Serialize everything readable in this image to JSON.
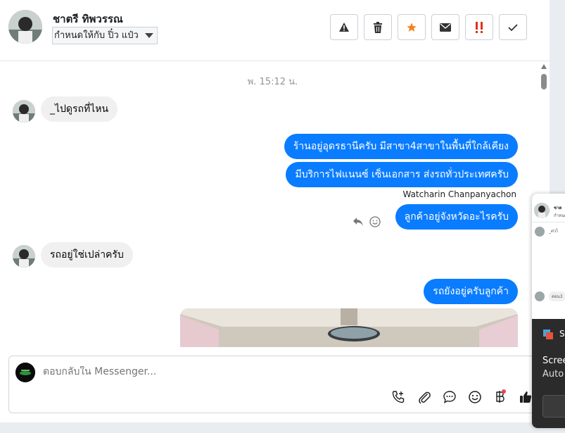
{
  "header": {
    "contact_name": "ชาตรี ทิพวรรณ",
    "assign_label": "กำหนดให้กับ ปิ๋ว แป๋ว",
    "actions": [
      {
        "name": "alert-button",
        "icon": "warning-icon"
      },
      {
        "name": "delete-button",
        "icon": "trash-icon"
      },
      {
        "name": "star-button",
        "icon": "star-icon"
      },
      {
        "name": "mail-button",
        "icon": "envelope-icon"
      },
      {
        "name": "urgent-button",
        "icon": "double-exclamation-icon"
      },
      {
        "name": "done-button",
        "icon": "check-icon"
      }
    ]
  },
  "conversation": {
    "timestamp": "พ. 15:12 น.",
    "messages": [
      {
        "direction": "in",
        "text": "_ไปดูรถที่ไหน"
      },
      {
        "direction": "out",
        "text": "ร้านอยู่อุดรธานีครับ มีสาขา4สาขาในพื้นที่ใกล้เคียง"
      },
      {
        "direction": "out",
        "text": "มีบริการไฟแนนซ์ เซ็นเอกสาร ส่งรถทั่วประเทศครับ"
      },
      {
        "direction": "out",
        "text": "ลูกค้าอยู่จังหวัดอะไรครับ",
        "sender": "Watcharin Chanpanyachon"
      },
      {
        "direction": "in",
        "text": "รถอยู่ใช่เปล่าครับ"
      },
      {
        "direction": "out",
        "text": "รถยังอยู่ครับลูกค้า"
      }
    ]
  },
  "composer": {
    "placeholder": "ตอบกลับใน Messenger...",
    "tools": [
      "add-call-icon",
      "paperclip-icon",
      "chat-bubble-icon",
      "smiley-icon",
      "baht-icon",
      "thumbs-up-icon"
    ]
  },
  "side_panel": {
    "preview_name": "ชาต",
    "preview_sub": "กำหนด",
    "preview_msg_1": "_ต่วไ",
    "preview_msg_2": "ค่อน3",
    "notif_title": "S",
    "notif_line1": "Scree",
    "notif_line2": "Auto"
  },
  "colors": {
    "accent_blue": "#0a7cff",
    "incoming_bubble": "#f0f0f0",
    "star_orange": "#f5821f",
    "urgent_red": "#e0301e"
  }
}
